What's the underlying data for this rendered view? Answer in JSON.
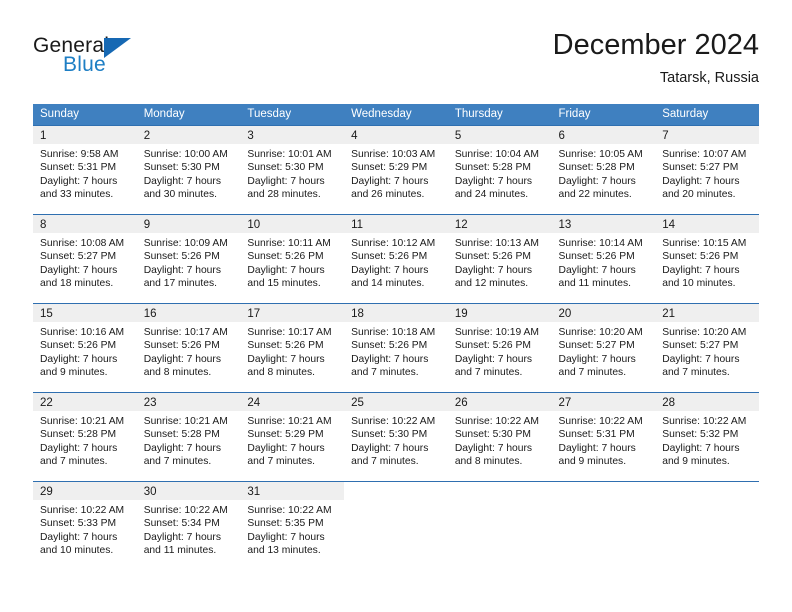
{
  "brand": {
    "word_one": "General",
    "word_two": "Blue",
    "triangle_icon": "brand-triangle-icon",
    "accent_color": "#1668b3"
  },
  "header": {
    "month_title": "December 2024",
    "location": "Tatarsk, Russia"
  },
  "theme": {
    "header_row_bg": "#3f80c0",
    "daynum_band_bg": "#efefef",
    "week_separator": "#2f6fb0",
    "text_color": "#1a1a1a"
  },
  "calendar": {
    "weekday_headers": [
      "Sunday",
      "Monday",
      "Tuesday",
      "Wednesday",
      "Thursday",
      "Friday",
      "Saturday"
    ],
    "weeks": [
      [
        {
          "day": "1",
          "sunrise": "Sunrise: 9:58 AM",
          "sunset": "Sunset: 5:31 PM",
          "daylight_line1": "Daylight: 7 hours",
          "daylight_line2": "and 33 minutes."
        },
        {
          "day": "2",
          "sunrise": "Sunrise: 10:00 AM",
          "sunset": "Sunset: 5:30 PM",
          "daylight_line1": "Daylight: 7 hours",
          "daylight_line2": "and 30 minutes."
        },
        {
          "day": "3",
          "sunrise": "Sunrise: 10:01 AM",
          "sunset": "Sunset: 5:30 PM",
          "daylight_line1": "Daylight: 7 hours",
          "daylight_line2": "and 28 minutes."
        },
        {
          "day": "4",
          "sunrise": "Sunrise: 10:03 AM",
          "sunset": "Sunset: 5:29 PM",
          "daylight_line1": "Daylight: 7 hours",
          "daylight_line2": "and 26 minutes."
        },
        {
          "day": "5",
          "sunrise": "Sunrise: 10:04 AM",
          "sunset": "Sunset: 5:28 PM",
          "daylight_line1": "Daylight: 7 hours",
          "daylight_line2": "and 24 minutes."
        },
        {
          "day": "6",
          "sunrise": "Sunrise: 10:05 AM",
          "sunset": "Sunset: 5:28 PM",
          "daylight_line1": "Daylight: 7 hours",
          "daylight_line2": "and 22 minutes."
        },
        {
          "day": "7",
          "sunrise": "Sunrise: 10:07 AM",
          "sunset": "Sunset: 5:27 PM",
          "daylight_line1": "Daylight: 7 hours",
          "daylight_line2": "and 20 minutes."
        }
      ],
      [
        {
          "day": "8",
          "sunrise": "Sunrise: 10:08 AM",
          "sunset": "Sunset: 5:27 PM",
          "daylight_line1": "Daylight: 7 hours",
          "daylight_line2": "and 18 minutes."
        },
        {
          "day": "9",
          "sunrise": "Sunrise: 10:09 AM",
          "sunset": "Sunset: 5:26 PM",
          "daylight_line1": "Daylight: 7 hours",
          "daylight_line2": "and 17 minutes."
        },
        {
          "day": "10",
          "sunrise": "Sunrise: 10:11 AM",
          "sunset": "Sunset: 5:26 PM",
          "daylight_line1": "Daylight: 7 hours",
          "daylight_line2": "and 15 minutes."
        },
        {
          "day": "11",
          "sunrise": "Sunrise: 10:12 AM",
          "sunset": "Sunset: 5:26 PM",
          "daylight_line1": "Daylight: 7 hours",
          "daylight_line2": "and 14 minutes."
        },
        {
          "day": "12",
          "sunrise": "Sunrise: 10:13 AM",
          "sunset": "Sunset: 5:26 PM",
          "daylight_line1": "Daylight: 7 hours",
          "daylight_line2": "and 12 minutes."
        },
        {
          "day": "13",
          "sunrise": "Sunrise: 10:14 AM",
          "sunset": "Sunset: 5:26 PM",
          "daylight_line1": "Daylight: 7 hours",
          "daylight_line2": "and 11 minutes."
        },
        {
          "day": "14",
          "sunrise": "Sunrise: 10:15 AM",
          "sunset": "Sunset: 5:26 PM",
          "daylight_line1": "Daylight: 7 hours",
          "daylight_line2": "and 10 minutes."
        }
      ],
      [
        {
          "day": "15",
          "sunrise": "Sunrise: 10:16 AM",
          "sunset": "Sunset: 5:26 PM",
          "daylight_line1": "Daylight: 7 hours",
          "daylight_line2": "and 9 minutes."
        },
        {
          "day": "16",
          "sunrise": "Sunrise: 10:17 AM",
          "sunset": "Sunset: 5:26 PM",
          "daylight_line1": "Daylight: 7 hours",
          "daylight_line2": "and 8 minutes."
        },
        {
          "day": "17",
          "sunrise": "Sunrise: 10:17 AM",
          "sunset": "Sunset: 5:26 PM",
          "daylight_line1": "Daylight: 7 hours",
          "daylight_line2": "and 8 minutes."
        },
        {
          "day": "18",
          "sunrise": "Sunrise: 10:18 AM",
          "sunset": "Sunset: 5:26 PM",
          "daylight_line1": "Daylight: 7 hours",
          "daylight_line2": "and 7 minutes."
        },
        {
          "day": "19",
          "sunrise": "Sunrise: 10:19 AM",
          "sunset": "Sunset: 5:26 PM",
          "daylight_line1": "Daylight: 7 hours",
          "daylight_line2": "and 7 minutes."
        },
        {
          "day": "20",
          "sunrise": "Sunrise: 10:20 AM",
          "sunset": "Sunset: 5:27 PM",
          "daylight_line1": "Daylight: 7 hours",
          "daylight_line2": "and 7 minutes."
        },
        {
          "day": "21",
          "sunrise": "Sunrise: 10:20 AM",
          "sunset": "Sunset: 5:27 PM",
          "daylight_line1": "Daylight: 7 hours",
          "daylight_line2": "and 7 minutes."
        }
      ],
      [
        {
          "day": "22",
          "sunrise": "Sunrise: 10:21 AM",
          "sunset": "Sunset: 5:28 PM",
          "daylight_line1": "Daylight: 7 hours",
          "daylight_line2": "and 7 minutes."
        },
        {
          "day": "23",
          "sunrise": "Sunrise: 10:21 AM",
          "sunset": "Sunset: 5:28 PM",
          "daylight_line1": "Daylight: 7 hours",
          "daylight_line2": "and 7 minutes."
        },
        {
          "day": "24",
          "sunrise": "Sunrise: 10:21 AM",
          "sunset": "Sunset: 5:29 PM",
          "daylight_line1": "Daylight: 7 hours",
          "daylight_line2": "and 7 minutes."
        },
        {
          "day": "25",
          "sunrise": "Sunrise: 10:22 AM",
          "sunset": "Sunset: 5:30 PM",
          "daylight_line1": "Daylight: 7 hours",
          "daylight_line2": "and 7 minutes."
        },
        {
          "day": "26",
          "sunrise": "Sunrise: 10:22 AM",
          "sunset": "Sunset: 5:30 PM",
          "daylight_line1": "Daylight: 7 hours",
          "daylight_line2": "and 8 minutes."
        },
        {
          "day": "27",
          "sunrise": "Sunrise: 10:22 AM",
          "sunset": "Sunset: 5:31 PM",
          "daylight_line1": "Daylight: 7 hours",
          "daylight_line2": "and 9 minutes."
        },
        {
          "day": "28",
          "sunrise": "Sunrise: 10:22 AM",
          "sunset": "Sunset: 5:32 PM",
          "daylight_line1": "Daylight: 7 hours",
          "daylight_line2": "and 9 minutes."
        }
      ],
      [
        {
          "day": "29",
          "sunrise": "Sunrise: 10:22 AM",
          "sunset": "Sunset: 5:33 PM",
          "daylight_line1": "Daylight: 7 hours",
          "daylight_line2": "and 10 minutes."
        },
        {
          "day": "30",
          "sunrise": "Sunrise: 10:22 AM",
          "sunset": "Sunset: 5:34 PM",
          "daylight_line1": "Daylight: 7 hours",
          "daylight_line2": "and 11 minutes."
        },
        {
          "day": "31",
          "sunrise": "Sunrise: 10:22 AM",
          "sunset": "Sunset: 5:35 PM",
          "daylight_line1": "Daylight: 7 hours",
          "daylight_line2": "and 13 minutes."
        },
        {
          "day": "",
          "sunrise": "",
          "sunset": "",
          "daylight_line1": "",
          "daylight_line2": ""
        },
        {
          "day": "",
          "sunrise": "",
          "sunset": "",
          "daylight_line1": "",
          "daylight_line2": ""
        },
        {
          "day": "",
          "sunrise": "",
          "sunset": "",
          "daylight_line1": "",
          "daylight_line2": ""
        },
        {
          "day": "",
          "sunrise": "",
          "sunset": "",
          "daylight_line1": "",
          "daylight_line2": ""
        }
      ]
    ]
  }
}
